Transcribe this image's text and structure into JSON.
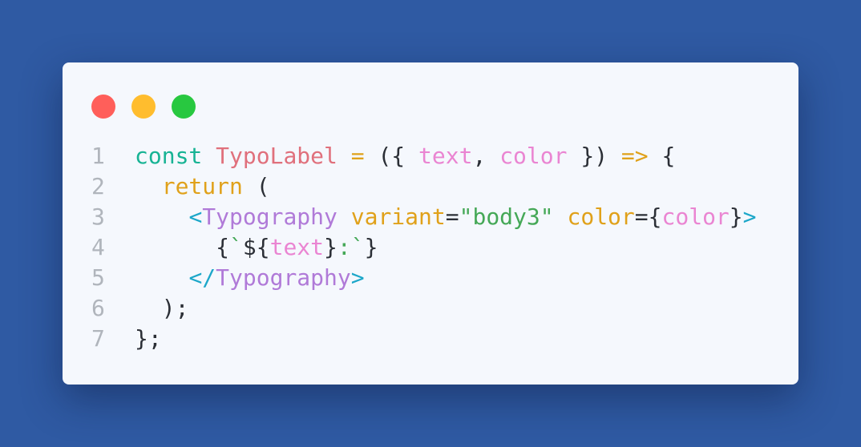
{
  "window": {
    "controls": [
      {
        "name": "close",
        "color": "#ff5f5a"
      },
      {
        "name": "minimize",
        "color": "#ffbd2e"
      },
      {
        "name": "maximize",
        "color": "#28c840"
      }
    ]
  },
  "code": {
    "lines": [
      {
        "number": "1",
        "tokens": [
          {
            "text": "const",
            "type": "keyword"
          },
          {
            "text": " ",
            "type": "punct"
          },
          {
            "text": "TypoLabel",
            "type": "ident"
          },
          {
            "text": " ",
            "type": "punct"
          },
          {
            "text": "=",
            "type": "op"
          },
          {
            "text": " ({ ",
            "type": "punct"
          },
          {
            "text": "text",
            "type": "param"
          },
          {
            "text": ", ",
            "type": "punct"
          },
          {
            "text": "color",
            "type": "param"
          },
          {
            "text": " }) ",
            "type": "punct"
          },
          {
            "text": "=>",
            "type": "op"
          },
          {
            "text": " {",
            "type": "punct"
          }
        ]
      },
      {
        "number": "2",
        "tokens": [
          {
            "text": "  ",
            "type": "punct"
          },
          {
            "text": "return",
            "type": "ret"
          },
          {
            "text": " (",
            "type": "punct"
          }
        ]
      },
      {
        "number": "3",
        "tokens": [
          {
            "text": "    ",
            "type": "punct"
          },
          {
            "text": "<",
            "type": "tag"
          },
          {
            "text": "Typography",
            "type": "comp"
          },
          {
            "text": " ",
            "type": "punct"
          },
          {
            "text": "variant",
            "type": "attr"
          },
          {
            "text": "=",
            "type": "punct"
          },
          {
            "text": "\"body3\"",
            "type": "string"
          },
          {
            "text": " ",
            "type": "punct"
          },
          {
            "text": "color",
            "type": "attr"
          },
          {
            "text": "={",
            "type": "punct"
          },
          {
            "text": "color",
            "type": "param"
          },
          {
            "text": "}",
            "type": "punct"
          },
          {
            "text": ">",
            "type": "tag"
          }
        ]
      },
      {
        "number": "4",
        "tokens": [
          {
            "text": "      {",
            "type": "punct"
          },
          {
            "text": "`",
            "type": "tpl"
          },
          {
            "text": "${",
            "type": "punct"
          },
          {
            "text": "text",
            "type": "param"
          },
          {
            "text": "}",
            "type": "punct"
          },
          {
            "text": ":`",
            "type": "tpl"
          },
          {
            "text": "}",
            "type": "punct"
          }
        ]
      },
      {
        "number": "5",
        "tokens": [
          {
            "text": "    ",
            "type": "punct"
          },
          {
            "text": "</",
            "type": "tag"
          },
          {
            "text": "Typography",
            "type": "comp"
          },
          {
            "text": ">",
            "type": "tag"
          }
        ]
      },
      {
        "number": "6",
        "tokens": [
          {
            "text": "  );",
            "type": "punct"
          }
        ]
      },
      {
        "number": "7",
        "tokens": [
          {
            "text": "};",
            "type": "punct"
          }
        ]
      }
    ]
  }
}
